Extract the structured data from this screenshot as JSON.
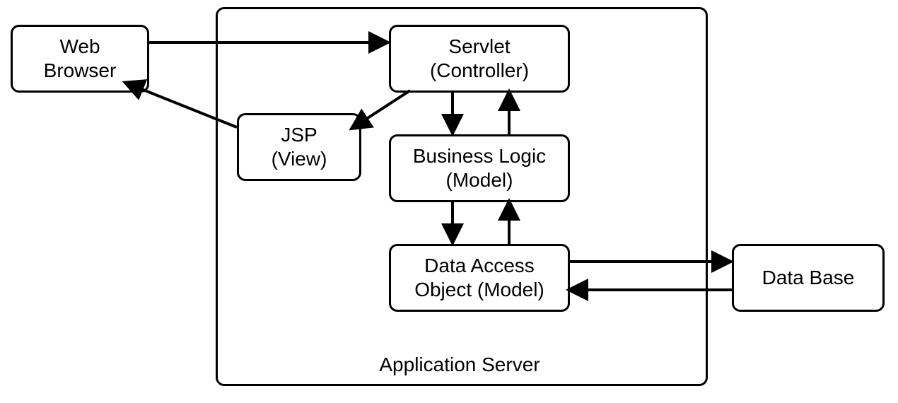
{
  "nodes": {
    "webBrowser": {
      "line1": "Web",
      "line2": "Browser"
    },
    "servlet": {
      "line1": "Servlet",
      "line2": "(Controller)"
    },
    "jsp": {
      "line1": "JSP",
      "line2": "(View)"
    },
    "businessLogic": {
      "line1": "Business Logic",
      "line2": "(Model)"
    },
    "dao": {
      "line1": "Data Access",
      "line2": "Object (Model)"
    },
    "database": {
      "line1": "Data Base"
    }
  },
  "container": {
    "label": "Application Server"
  },
  "relationships": [
    {
      "from": "webBrowser",
      "to": "servlet",
      "direction": "uni"
    },
    {
      "from": "servlet",
      "to": "jsp",
      "direction": "uni"
    },
    {
      "from": "jsp",
      "to": "webBrowser",
      "direction": "uni"
    },
    {
      "from": "servlet",
      "to": "businessLogic",
      "direction": "bi"
    },
    {
      "from": "businessLogic",
      "to": "dao",
      "direction": "bi"
    },
    {
      "from": "dao",
      "to": "database",
      "direction": "bi"
    }
  ]
}
